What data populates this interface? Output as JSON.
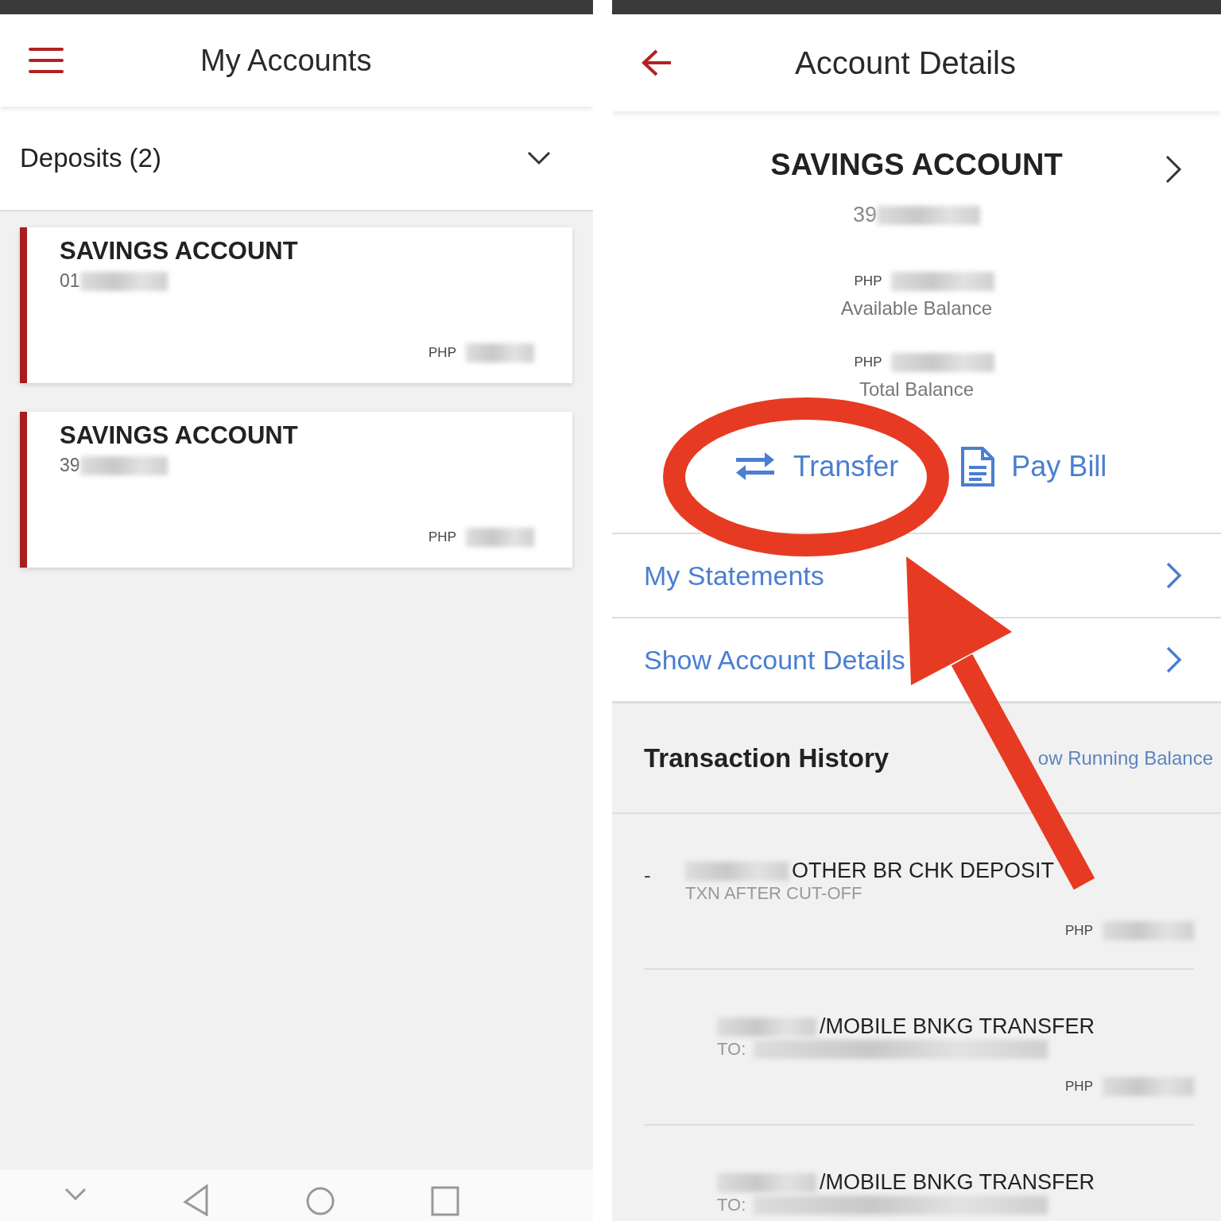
{
  "left_screen": {
    "header": {
      "title": "My Accounts"
    },
    "section": {
      "title": "Deposits (2)",
      "expanded": true
    },
    "accounts": [
      {
        "name": "SAVINGS ACCOUNT",
        "number": "01",
        "currency": "PHP"
      },
      {
        "name": "SAVINGS ACCOUNT",
        "number": "39",
        "currency": "PHP"
      }
    ]
  },
  "right_screen": {
    "header": {
      "title": "Account Details"
    },
    "account": {
      "name": "SAVINGS ACCOUNT",
      "number": "39"
    },
    "balances": [
      {
        "currency": "PHP",
        "label": "Available Balance"
      },
      {
        "currency": "PHP",
        "label": "Total Balance"
      }
    ],
    "actions": [
      {
        "kind": "transfer",
        "label": "Transfer"
      },
      {
        "kind": "bill",
        "label": "Pay Bill"
      }
    ],
    "links": [
      {
        "label": "My Statements"
      },
      {
        "label": "Show Account Details"
      }
    ],
    "history": {
      "title": "Transaction History",
      "toggle": "ow Running Balance"
    },
    "transactions": [
      {
        "marker": "-",
        "title": "OTHER BR CHK DEPOSIT",
        "subtitle": "TXN AFTER CUT-OFF",
        "currency": "PHP"
      },
      {
        "title": "/MOBILE BNKG TRANSFER",
        "subtitle": "TO:",
        "currency": "PHP"
      },
      {
        "title": "/MOBILE BNKG TRANSFER",
        "subtitle": "TO:"
      }
    ]
  },
  "annotations": {
    "highlight_ellipse": {
      "color": "#e63b22"
    },
    "pointer_arrow": {
      "color": "#e63b22"
    }
  }
}
